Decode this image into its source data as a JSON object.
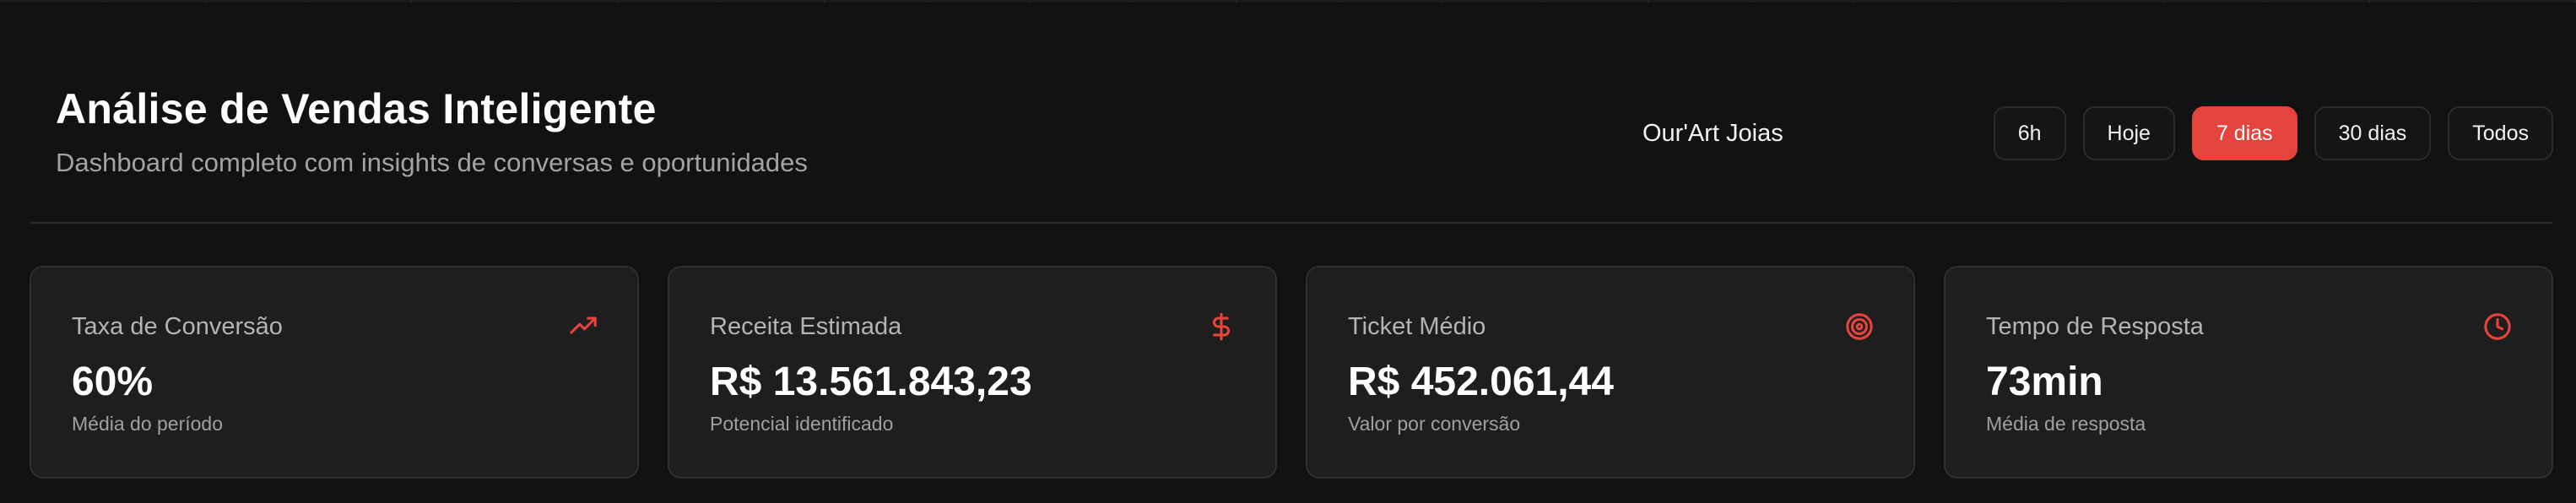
{
  "header": {
    "title": "Análise de Vendas Inteligente",
    "subtitle": "Dashboard completo com insights de conversas e oportunidades",
    "company": "Our'Art Joias"
  },
  "time_ranges": [
    {
      "label": "6h",
      "active": false
    },
    {
      "label": "Hoje",
      "active": false
    },
    {
      "label": "7 dias",
      "active": true
    },
    {
      "label": "30 dias",
      "active": false
    },
    {
      "label": "Todos",
      "active": false
    }
  ],
  "cards": [
    {
      "label": "Taxa de Conversão",
      "value": "60%",
      "caption": "Média do período",
      "icon": "trending-up-icon"
    },
    {
      "label": "Receita Estimada",
      "value": "R$ 13.561.843,23",
      "caption": "Potencial identificado",
      "icon": "dollar-icon"
    },
    {
      "label": "Ticket Médio",
      "value": "R$ 452.061,44",
      "caption": "Valor por conversão",
      "icon": "target-icon"
    },
    {
      "label": "Tempo de Resposta",
      "value": "73min",
      "caption": "Média de resposta",
      "icon": "clock-icon"
    }
  ],
  "colors": {
    "accent": "#e5443c",
    "background": "#121212",
    "card": "#1e1e1e"
  }
}
